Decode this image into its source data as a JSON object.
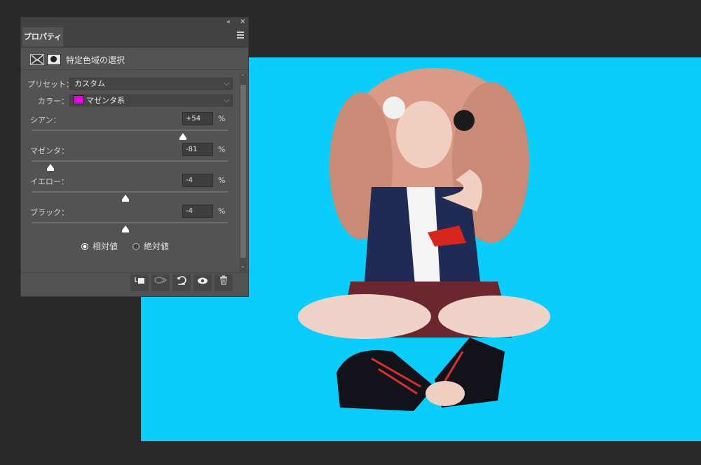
{
  "panel": {
    "tab_label": "プロパティ",
    "collapse_icon": "«",
    "close_icon": "✕",
    "title": "特定色域の選択",
    "preset": {
      "label": "プリセット：",
      "value": "カスタム"
    },
    "colors": {
      "label": "カラー：",
      "value": "マゼンタ系",
      "swatch_color": "#e400e4"
    },
    "sliders": [
      {
        "label": "シアン：",
        "value": "+54",
        "unit": "%",
        "level": 77
      },
      {
        "label": "マゼンタ：",
        "value": "-81",
        "unit": "%",
        "level": 9.5
      },
      {
        "label": "イエロー：",
        "value": "-4",
        "unit": "%",
        "level": 48
      },
      {
        "label": "ブラック：",
        "value": "-4",
        "unit": "%",
        "level": 48
      }
    ],
    "method": {
      "relative_label": "相対値",
      "absolute_label": "絶対値",
      "selected": "relative"
    }
  },
  "canvas": {
    "background": "#0acdfb"
  }
}
